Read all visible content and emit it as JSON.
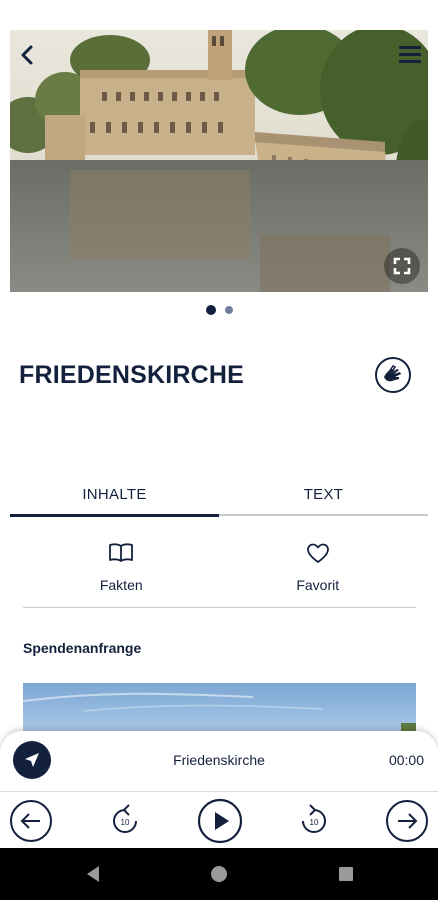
{
  "hero": {
    "image_alt": "Friedenskirche Potsdam am Wasser",
    "slide_count": 2,
    "active_slide": 0
  },
  "header": {
    "back_icon": "chevron-left-icon",
    "menu_icon": "hamburger-menu-icon",
    "fullscreen_icon": "fullscreen-icon"
  },
  "place": {
    "title": "FRIEDENSKIRCHE",
    "sign_language_icon": "sign-language-icon"
  },
  "tabs": [
    {
      "label": "INHALTE",
      "active": true
    },
    {
      "label": "TEXT",
      "active": false
    }
  ],
  "actions": [
    {
      "label": "Fakten",
      "icon": "book-icon"
    },
    {
      "label": "Favorit",
      "icon": "heart-icon"
    }
  ],
  "section": {
    "title": "Spendenanfrange"
  },
  "player": {
    "title": "Friedenskirche",
    "time": "00:00",
    "nav_icon": "navigation-arrow-icon",
    "rewind_seconds": "10",
    "forward_seconds": "10"
  },
  "colors": {
    "primary": "#14213d",
    "secondary_dot": "#6e7fa0",
    "divider": "#c8ccd4",
    "sky": "#9dbfe3"
  }
}
